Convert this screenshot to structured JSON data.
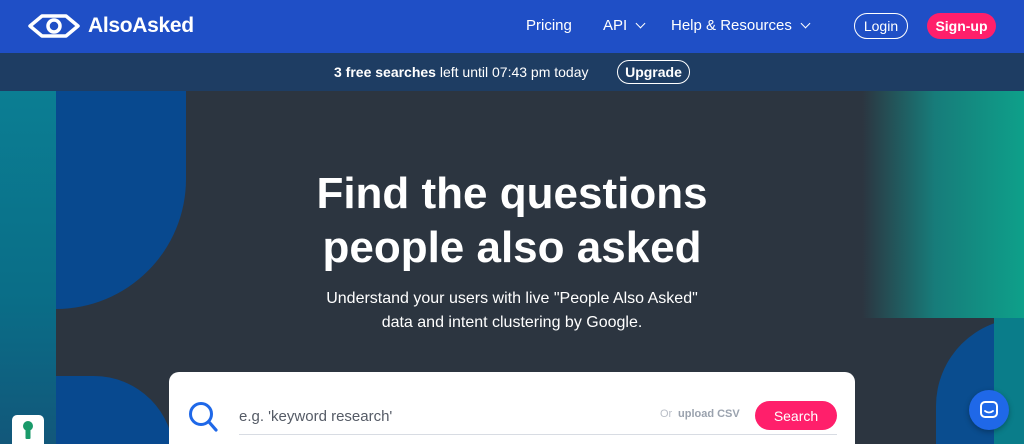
{
  "brand": {
    "name": "AlsoAsked"
  },
  "nav": {
    "items": [
      {
        "label": "Pricing",
        "has_dropdown": false
      },
      {
        "label": "API",
        "has_dropdown": true
      },
      {
        "label": "Help & Resources",
        "has_dropdown": true
      }
    ],
    "login_label": "Login",
    "signup_label": "Sign-up"
  },
  "banner": {
    "searches_bold": "3 free searches",
    "searches_rest": " left until 07:43 pm today",
    "upgrade_label": "Upgrade"
  },
  "hero": {
    "title_line1": "Find the questions",
    "title_line2": "people also asked",
    "subtitle_line1": "Understand your users with live \"People Also Asked\"",
    "subtitle_line2": "data and intent clustering by Google."
  },
  "search": {
    "placeholder": "e.g. 'keyword research'",
    "or_label": "Or",
    "upload_label": "upload CSV",
    "button_label": "Search"
  },
  "colors": {
    "nav_bg": "#1f4fc6",
    "banner_bg": "#1e3d63",
    "accent_pink": "#ff1f6b",
    "hero_bg": "#2c3540"
  },
  "icons": {
    "logo": "eye-logo-icon",
    "search": "search-icon",
    "cookie": "keyhole-icon",
    "chat": "chat-icon"
  }
}
